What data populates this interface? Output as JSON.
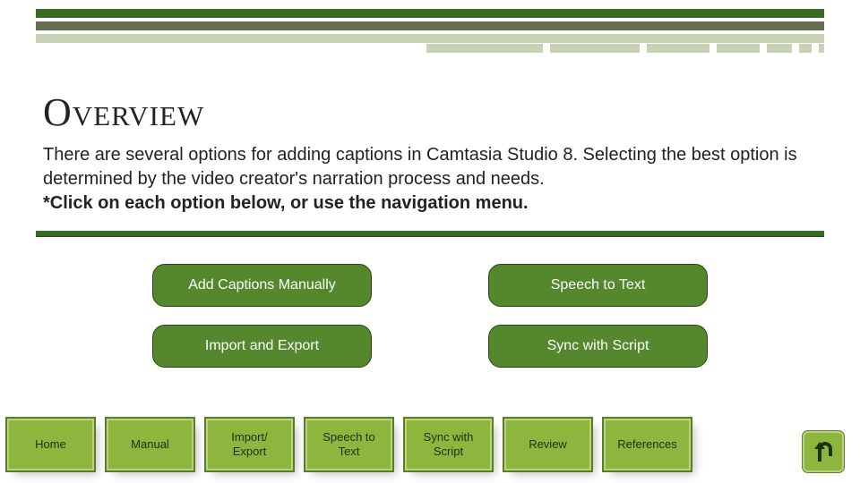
{
  "title": "Overview",
  "body": {
    "text": "There are several options for adding captions in Camtasia Studio 8. Selecting the best option is determined by the video creator's narration process and needs.",
    "instruction": "*Click on each option below, or use the navigation menu."
  },
  "options": {
    "manual": "Add Captions Manually",
    "speech": "Speech to Text",
    "import": "Import and Export",
    "sync": "Sync with Script"
  },
  "nav": {
    "home": "Home",
    "manual": "Manual",
    "import": "Import/\nExport",
    "speech": "Speech to\nText",
    "sync": "Sync with\nScript",
    "review": "Review",
    "references": "References"
  }
}
